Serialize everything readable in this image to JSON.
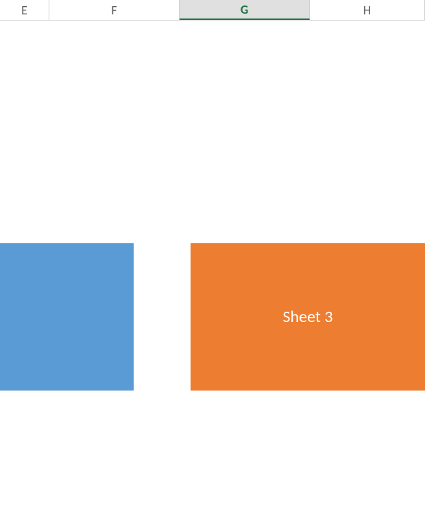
{
  "columns": {
    "e": "E",
    "f": "F",
    "g": "G",
    "h": "H"
  },
  "selected_column": "G",
  "shapes": {
    "blue": {
      "color": "#5b9bd5",
      "label": ""
    },
    "orange": {
      "color": "#ed7d31",
      "label": "Sheet 3"
    }
  }
}
